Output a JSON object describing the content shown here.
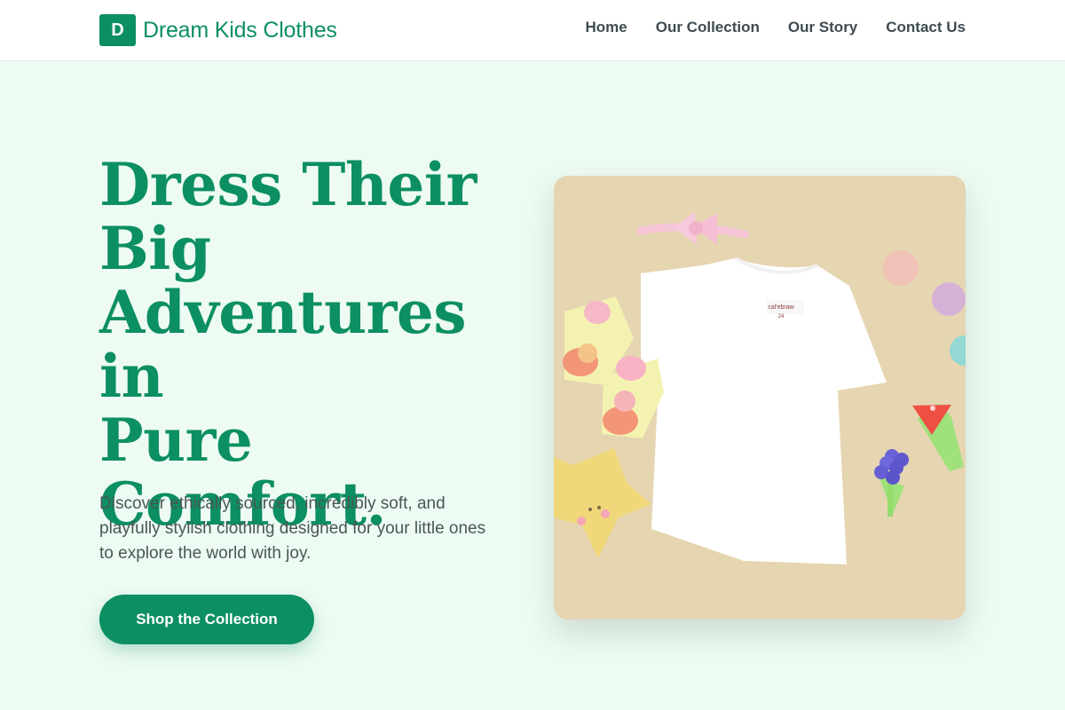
{
  "brand": {
    "mark": "D",
    "name": "Dream Kids Clothes"
  },
  "nav": {
    "items": [
      "Home",
      "Our Collection",
      "Our Story",
      "Contact Us"
    ]
  },
  "hero": {
    "title_lines": [
      "Dress Their",
      "Big",
      "Adventures in",
      "Pure",
      "Comfort."
    ],
    "description": "Discover ethically sourced, incredibly soft, and playfully stylish clothing designed for your little ones to explore the world with joy.",
    "cta_label": "Shop the Collection"
  },
  "image": {
    "icon": "product-photo",
    "shirt_label": "cal'ebraw",
    "shirt_size": "24"
  },
  "colors": {
    "brand": "#0c8f62",
    "background": "#edfbf2",
    "photo_background": "#e5d5b0"
  }
}
